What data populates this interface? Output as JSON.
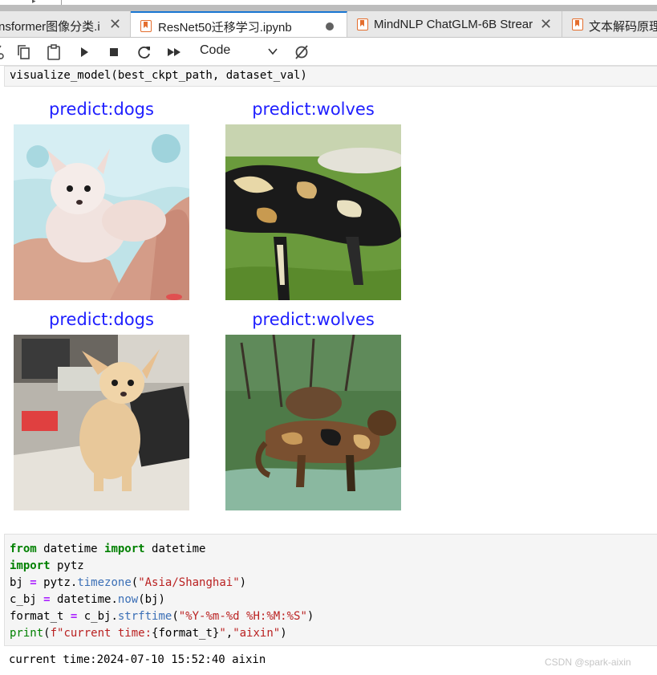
{
  "tabs": [
    {
      "label": "nsformer图像分类.i",
      "close": "✕",
      "active": false
    },
    {
      "label": "ResNet50迁移学习.ipynb",
      "active": true,
      "dirty": true
    },
    {
      "label": "MindNLP ChatGLM-6B Strear",
      "close": "✕",
      "active": false
    },
    {
      "label": "文本解码原理",
      "active": false
    }
  ],
  "toolbar": {
    "icons": [
      "copy-icon",
      "paste-icon",
      "run-icon",
      "stop-icon",
      "restart-icon",
      "fast-forward-icon",
      "kernel-status-icon"
    ],
    "cell_type": "Code"
  },
  "cell1": {
    "code": "visualize_model(best_ckpt_path, dataset_val)"
  },
  "figure": {
    "panels": [
      {
        "title": "predict:dogs",
        "label": "dogs"
      },
      {
        "title": "predict:wolves",
        "label": "wolves"
      },
      {
        "title": "predict:dogs",
        "label": "dogs"
      },
      {
        "title": "predict:wolves",
        "label": "wolves"
      }
    ]
  },
  "cell2": {
    "line1": {
      "kw1": "from",
      "mod": " datetime ",
      "kw2": "import",
      "name": " datetime"
    },
    "line2": {
      "kw": "import",
      "rest": " pytz"
    },
    "line3": {
      "a": "bj ",
      "eq": "=",
      "b": " pytz.",
      "fn": "timezone",
      "c": "(",
      "str": "\"Asia/Shanghai\"",
      "d": ")"
    },
    "line4": {
      "a": "c_bj ",
      "eq": "=",
      "b": " datetime.",
      "fn": "now",
      "c": "(bj)"
    },
    "line5": {
      "a": "format_t ",
      "eq": "=",
      "b": " c_bj.",
      "fn": "strftime",
      "c": "(",
      "str": "\"%Y-%m-%d %H:%M:%S\"",
      "d": ")"
    },
    "line6": {
      "bi": "print",
      "a": "(",
      "str1": "f\"current time:",
      "b": "{format_t}",
      "str2": "\"",
      "c": ",",
      "str3": "\"aixin\"",
      "d": ")"
    }
  },
  "output": {
    "text": "current time:2024-07-10 15:52:40 aixin"
  },
  "watermark": "CSDN @spark-aixin"
}
